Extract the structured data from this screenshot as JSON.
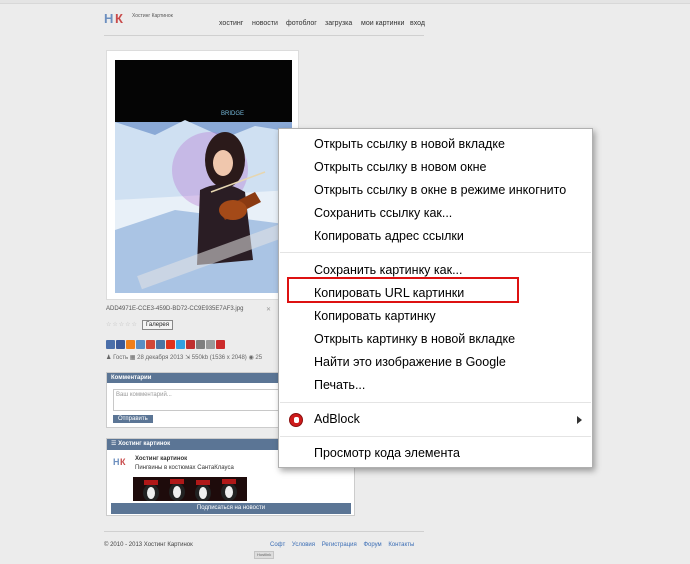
{
  "site": {
    "logo_letters": [
      "Н",
      "К"
    ],
    "logo_sub": "Хостинг Картинок",
    "nav": [
      "хостинг",
      "новости",
      "фотоблог",
      "загрузка",
      "мои картинки",
      "вход"
    ]
  },
  "image": {
    "filename": "ADD4971E-CCE3-459D-BD72-CC9E935E7AF3.jpg",
    "gallery_label": "Галерея",
    "share_colors": [
      "#4a6ea9",
      "#3b5998",
      "#ef7f1a",
      "#5a8ec4",
      "#d34836",
      "#4c75a3",
      "#e0321b",
      "#31a0e2",
      "#bf3030",
      "#7f7f7f",
      "#999999",
      "#cc2b2b"
    ],
    "meta_author": "Гость",
    "meta_date": "28 декабря 2013",
    "meta_size": "550kb (1536 x 2048)",
    "meta_views": "25"
  },
  "comments": {
    "title": "Комментарии",
    "placeholder": "Ваш комментарий...",
    "send_label": "Отправить"
  },
  "hosting": {
    "title": "Хостинг картинок",
    "item_title": "Хостинг картинок",
    "item_desc": "Пингвины в костюмах СантаКлауса",
    "subscribe": "Подписаться на новости"
  },
  "footer": {
    "copyright": "© 2010 - 2013 Хостинг Картинок",
    "links": [
      "Софт",
      "Условия",
      "Регистрация",
      "Форум",
      "Контакты"
    ],
    "counter": "Hostlink"
  },
  "context_menu": {
    "items": [
      "Открыть ссылку в новой вкладке",
      "Открыть ссылку в новом окне",
      "Открыть ссылку в окне в режиме инкогнито",
      "Сохранить ссылку как...",
      "Копировать адрес ссылки",
      "Сохранить картинку как...",
      "Копировать URL картинки",
      "Копировать картинку",
      "Открыть картинку в новой вкладке",
      "Найти это изображение в Google",
      "Печать...",
      "AdBlock",
      "Просмотр кода элемента"
    ],
    "highlighted_index": 6,
    "highlight_color": "#dd1111"
  }
}
